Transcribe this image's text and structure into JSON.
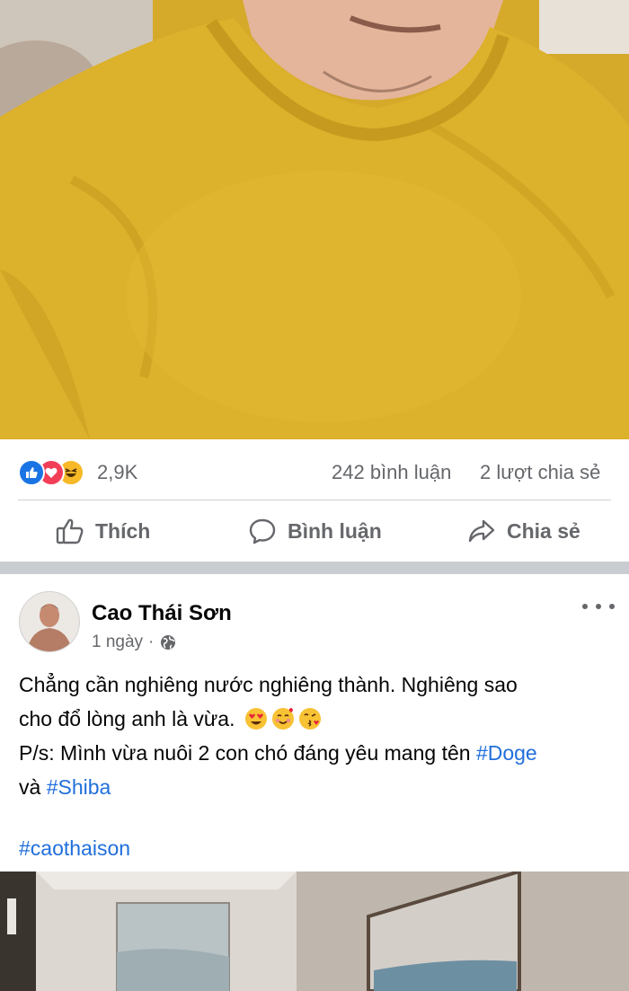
{
  "top_post": {
    "reactions": {
      "icons": [
        "like-icon",
        "love-icon",
        "haha-icon"
      ],
      "count": "2,9K",
      "comments": "242 bình luận",
      "shares": "2 lượt chia sẻ"
    },
    "actions": {
      "like_label": "Thích",
      "comment_label": "Bình luận",
      "share_label": "Chia sẻ"
    }
  },
  "post": {
    "author": "Cao Thái Sơn",
    "time": "1 ngày",
    "privacy_icon": "globe-icon",
    "text_line1": "Chẳng cần nghiêng nước nghiêng thành. Nghiêng sao",
    "text_line2": "cho đổ lòng anh là vừa.",
    "text_line3": "P/s: Mình vừa nuôi 2 con chó đáng yêu mang tên",
    "hashtag_doge": "#Doge",
    "text_and": "và",
    "hashtag_shiba": "#Shiba",
    "hashtag_main": "#caothaison",
    "emojis": [
      "heart-eyes-emoji",
      "smiling-hearts-emoji",
      "kissing-heart-emoji"
    ]
  },
  "colors": {
    "accent": "#1b74e4",
    "hashtag": "#216fdb",
    "secondary_text": "#65676b",
    "separator": "#c9ccd1"
  }
}
